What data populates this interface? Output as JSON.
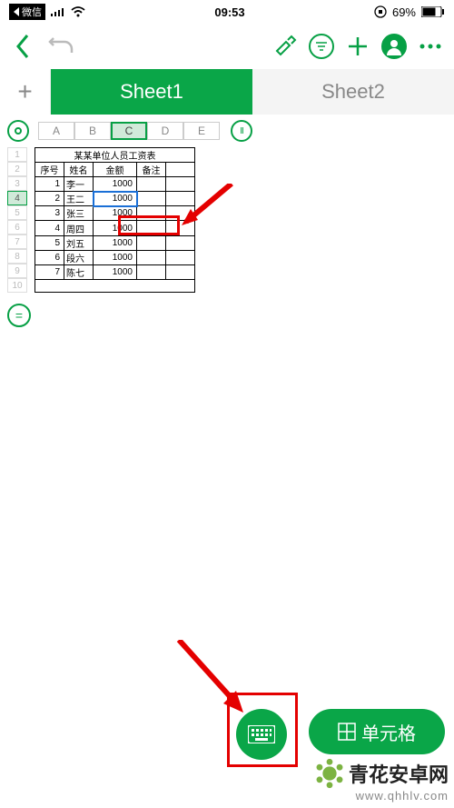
{
  "status": {
    "app_back": "微信",
    "signal": "ııll",
    "wifi": "wifi",
    "time": "09:53",
    "lock": "lock",
    "battery_pct": "69%"
  },
  "tabs": {
    "add": "+",
    "sheet1": "Sheet1",
    "sheet2": "Sheet2"
  },
  "columns": [
    "A",
    "B",
    "C",
    "D",
    "E"
  ],
  "selected_col": "C",
  "rows": [
    "1",
    "2",
    "3",
    "4",
    "5",
    "6",
    "7",
    "8",
    "9",
    "10"
  ],
  "selected_row": "4",
  "table": {
    "title": "某某单位人员工资表",
    "headers": [
      "序号",
      "姓名",
      "金额",
      "备注"
    ],
    "rows": [
      {
        "no": "1",
        "name": "李一",
        "amt": "1000",
        "note": ""
      },
      {
        "no": "2",
        "name": "王二",
        "amt": "1000",
        "note": ""
      },
      {
        "no": "3",
        "name": "张三",
        "amt": "1000",
        "note": ""
      },
      {
        "no": "4",
        "name": "周四",
        "amt": "1000",
        "note": ""
      },
      {
        "no": "5",
        "name": "刘五",
        "amt": "1000",
        "note": ""
      },
      {
        "no": "6",
        "name": "段六",
        "amt": "1000",
        "note": ""
      },
      {
        "no": "7",
        "name": "陈七",
        "amt": "1000",
        "note": ""
      }
    ]
  },
  "eq": "=",
  "pause": "II",
  "circle_o": "O",
  "float_cell_label": "单元格",
  "watermark": {
    "name": "青花安卓网",
    "url": "www.qhhlv.com"
  }
}
